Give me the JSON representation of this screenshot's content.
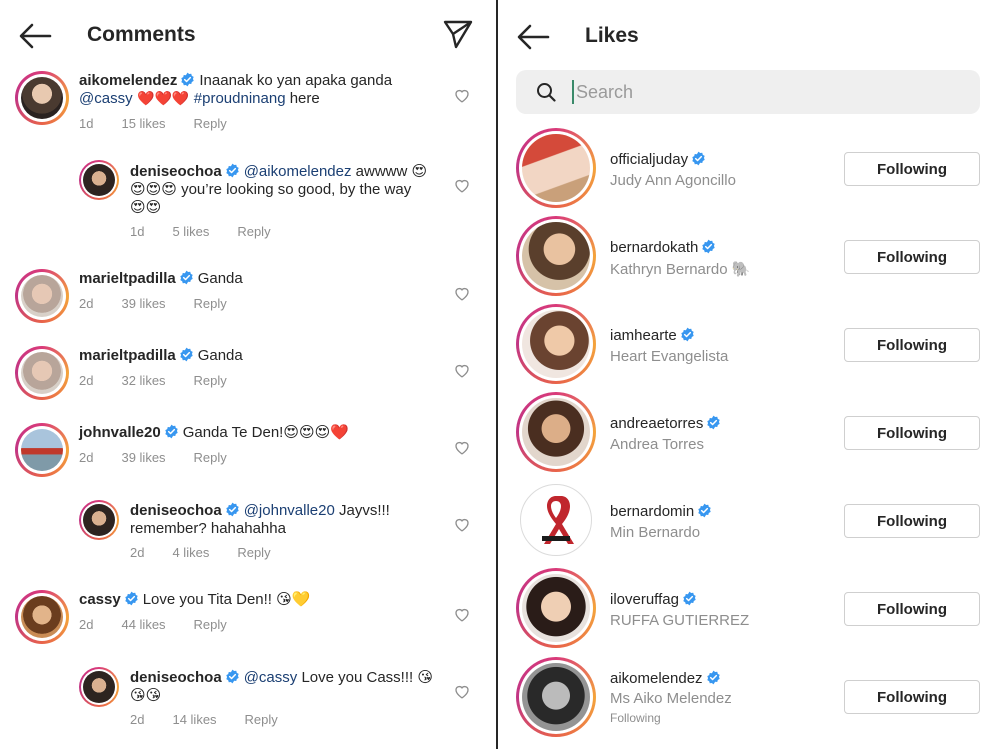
{
  "comments_screen": {
    "title": "Comments",
    "comments": [
      {
        "user": "aikomelendez",
        "text_line1": "Inaanak ko yan apaka ganda",
        "mention": "@cassy",
        "hearts": "❤️❤️❤️",
        "hashtag": "#proudninang",
        "tail": " here",
        "time": "1d",
        "likes": "15 likes",
        "reply": "Reply"
      },
      {
        "user": "deniseochoa",
        "mention": "@aikomelendez",
        "text_a": " awwww 😍",
        "text_b": "😍😍😍 you’re looking so good, by the way",
        "text_c": "😍😍",
        "time": "1d",
        "likes": "5 likes",
        "reply": "Reply"
      },
      {
        "user": "marieltpadilla",
        "text": "Ganda",
        "time": "2d",
        "likes": "39 likes",
        "reply": "Reply"
      },
      {
        "user": "marieltpadilla",
        "text": "Ganda",
        "time": "2d",
        "likes": "32 likes",
        "reply": "Reply"
      },
      {
        "user": "johnvalle20",
        "text": "Ganda Te Den!😍😍😍❤️",
        "time": "2d",
        "likes": "39 likes",
        "reply": "Reply"
      },
      {
        "user": "deniseochoa",
        "mention": "@johnvalle20",
        "text_a": " Jayvs!!!",
        "text_b": "remember? hahahahha",
        "time": "2d",
        "likes": "4 likes",
        "reply": "Reply"
      },
      {
        "user": "cassy",
        "text": "Love you Tita Den!! 😘💛",
        "time": "2d",
        "likes": "44 likes",
        "reply": "Reply"
      },
      {
        "user": "deniseochoa",
        "mention": "@cassy",
        "text_a": " Love you Cass!!! 😘",
        "text_b": "😘😘",
        "time": "2d",
        "likes": "14 likes",
        "reply": "Reply"
      }
    ]
  },
  "likes_screen": {
    "title": "Likes",
    "search": {
      "placeholder": "Search"
    },
    "users": [
      {
        "username": "officialjuday",
        "name": "Judy Ann Agoncillo",
        "button": "Following"
      },
      {
        "username": "bernardokath",
        "name": "Kathryn Bernardo 🐘",
        "button": "Following"
      },
      {
        "username": "iamhearte",
        "name": "Heart Evangelista",
        "button": "Following"
      },
      {
        "username": "andreaetorres",
        "name": "Andrea Torres",
        "button": "Following"
      },
      {
        "username": "bernardomin",
        "name": "Min Bernardo",
        "button": "Following"
      },
      {
        "username": "iloveruffag",
        "name": "RUFFA GUTIERREZ",
        "button": "Following"
      },
      {
        "username": "aikomelendez",
        "name": "Ms Aiko Melendez",
        "sub": "Following",
        "button": "Following"
      }
    ]
  },
  "colors": {
    "verified": "#3897f0",
    "mention": "#1b3f73",
    "meta": "#8e8e8e",
    "search_bg": "#efefef"
  }
}
